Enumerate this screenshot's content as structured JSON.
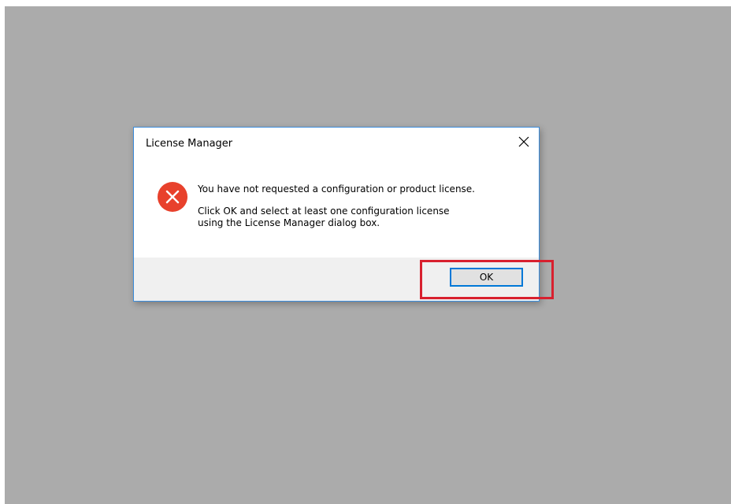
{
  "dialog": {
    "title": "License  Manager",
    "message_line1": "You have not requested a configuration or product license.",
    "message_line2a": "Click OK and select at least one configuration license",
    "message_line2b": "using the License Manager dialog box.",
    "ok_label": "OK",
    "icon": "error-icon"
  },
  "colors": {
    "desktop": "#ababab",
    "dialog_border": "#3c8ddc",
    "error_red": "#e8412c",
    "highlight": "#d8202e",
    "button_focus": "#0078d7"
  }
}
